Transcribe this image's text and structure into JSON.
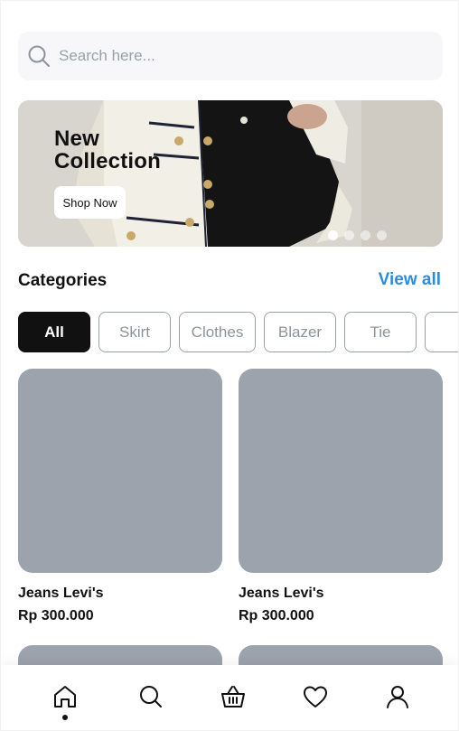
{
  "search": {
    "placeholder": "Search here..."
  },
  "banner": {
    "title": "New\nCollection",
    "button_label": "Shop Now",
    "slides": 4,
    "active_slide": 1
  },
  "categories": {
    "title": "Categories",
    "view_all": "View all",
    "chips": [
      "All",
      "Skirt",
      "Clothes",
      "Blazer",
      "Tie"
    ],
    "selected": "All"
  },
  "products": [
    {
      "name": "Jeans Levi's",
      "price": "Rp 300.000"
    },
    {
      "name": "Jeans Levi's",
      "price": "Rp 300.000"
    }
  ],
  "colors": {
    "accent": "#2b8de0",
    "chip_active": "#111111",
    "placeholder_image": "#9ca3ad"
  },
  "bottom_nav": {
    "items": [
      "home-icon",
      "search-icon",
      "basket-icon",
      "heart-icon",
      "user-icon"
    ],
    "active": "home-icon"
  }
}
